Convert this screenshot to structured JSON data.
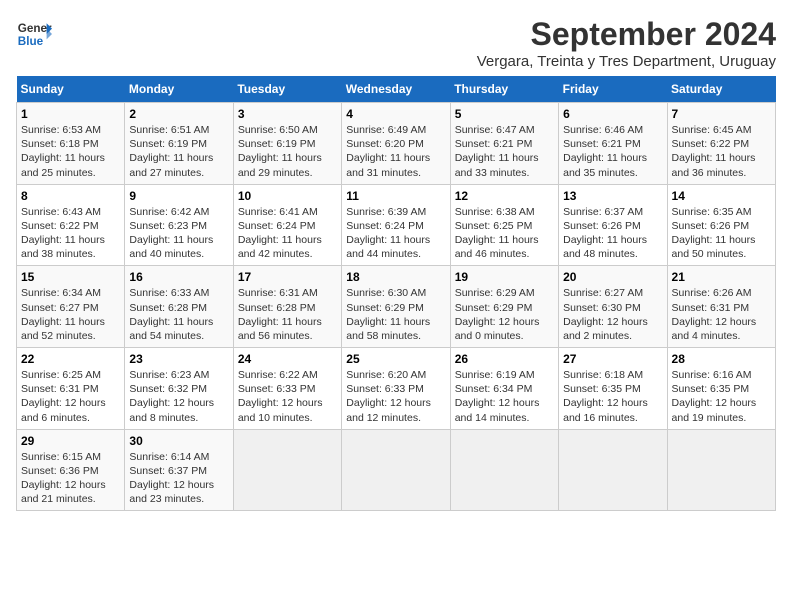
{
  "header": {
    "logo_line1": "General",
    "logo_line2": "Blue",
    "main_title": "September 2024",
    "subtitle": "Vergara, Treinta y Tres Department, Uruguay"
  },
  "days_of_week": [
    "Sunday",
    "Monday",
    "Tuesday",
    "Wednesday",
    "Thursday",
    "Friday",
    "Saturday"
  ],
  "weeks": [
    [
      {
        "day": "1",
        "lines": [
          "Sunrise: 6:53 AM",
          "Sunset: 6:18 PM",
          "Daylight: 11 hours",
          "and 25 minutes."
        ]
      },
      {
        "day": "2",
        "lines": [
          "Sunrise: 6:51 AM",
          "Sunset: 6:19 PM",
          "Daylight: 11 hours",
          "and 27 minutes."
        ]
      },
      {
        "day": "3",
        "lines": [
          "Sunrise: 6:50 AM",
          "Sunset: 6:19 PM",
          "Daylight: 11 hours",
          "and 29 minutes."
        ]
      },
      {
        "day": "4",
        "lines": [
          "Sunrise: 6:49 AM",
          "Sunset: 6:20 PM",
          "Daylight: 11 hours",
          "and 31 minutes."
        ]
      },
      {
        "day": "5",
        "lines": [
          "Sunrise: 6:47 AM",
          "Sunset: 6:21 PM",
          "Daylight: 11 hours",
          "and 33 minutes."
        ]
      },
      {
        "day": "6",
        "lines": [
          "Sunrise: 6:46 AM",
          "Sunset: 6:21 PM",
          "Daylight: 11 hours",
          "and 35 minutes."
        ]
      },
      {
        "day": "7",
        "lines": [
          "Sunrise: 6:45 AM",
          "Sunset: 6:22 PM",
          "Daylight: 11 hours",
          "and 36 minutes."
        ]
      }
    ],
    [
      {
        "day": "8",
        "lines": [
          "Sunrise: 6:43 AM",
          "Sunset: 6:22 PM",
          "Daylight: 11 hours",
          "and 38 minutes."
        ]
      },
      {
        "day": "9",
        "lines": [
          "Sunrise: 6:42 AM",
          "Sunset: 6:23 PM",
          "Daylight: 11 hours",
          "and 40 minutes."
        ]
      },
      {
        "day": "10",
        "lines": [
          "Sunrise: 6:41 AM",
          "Sunset: 6:24 PM",
          "Daylight: 11 hours",
          "and 42 minutes."
        ]
      },
      {
        "day": "11",
        "lines": [
          "Sunrise: 6:39 AM",
          "Sunset: 6:24 PM",
          "Daylight: 11 hours",
          "and 44 minutes."
        ]
      },
      {
        "day": "12",
        "lines": [
          "Sunrise: 6:38 AM",
          "Sunset: 6:25 PM",
          "Daylight: 11 hours",
          "and 46 minutes."
        ]
      },
      {
        "day": "13",
        "lines": [
          "Sunrise: 6:37 AM",
          "Sunset: 6:26 PM",
          "Daylight: 11 hours",
          "and 48 minutes."
        ]
      },
      {
        "day": "14",
        "lines": [
          "Sunrise: 6:35 AM",
          "Sunset: 6:26 PM",
          "Daylight: 11 hours",
          "and 50 minutes."
        ]
      }
    ],
    [
      {
        "day": "15",
        "lines": [
          "Sunrise: 6:34 AM",
          "Sunset: 6:27 PM",
          "Daylight: 11 hours",
          "and 52 minutes."
        ]
      },
      {
        "day": "16",
        "lines": [
          "Sunrise: 6:33 AM",
          "Sunset: 6:28 PM",
          "Daylight: 11 hours",
          "and 54 minutes."
        ]
      },
      {
        "day": "17",
        "lines": [
          "Sunrise: 6:31 AM",
          "Sunset: 6:28 PM",
          "Daylight: 11 hours",
          "and 56 minutes."
        ]
      },
      {
        "day": "18",
        "lines": [
          "Sunrise: 6:30 AM",
          "Sunset: 6:29 PM",
          "Daylight: 11 hours",
          "and 58 minutes."
        ]
      },
      {
        "day": "19",
        "lines": [
          "Sunrise: 6:29 AM",
          "Sunset: 6:29 PM",
          "Daylight: 12 hours",
          "and 0 minutes."
        ]
      },
      {
        "day": "20",
        "lines": [
          "Sunrise: 6:27 AM",
          "Sunset: 6:30 PM",
          "Daylight: 12 hours",
          "and 2 minutes."
        ]
      },
      {
        "day": "21",
        "lines": [
          "Sunrise: 6:26 AM",
          "Sunset: 6:31 PM",
          "Daylight: 12 hours",
          "and 4 minutes."
        ]
      }
    ],
    [
      {
        "day": "22",
        "lines": [
          "Sunrise: 6:25 AM",
          "Sunset: 6:31 PM",
          "Daylight: 12 hours",
          "and 6 minutes."
        ]
      },
      {
        "day": "23",
        "lines": [
          "Sunrise: 6:23 AM",
          "Sunset: 6:32 PM",
          "Daylight: 12 hours",
          "and 8 minutes."
        ]
      },
      {
        "day": "24",
        "lines": [
          "Sunrise: 6:22 AM",
          "Sunset: 6:33 PM",
          "Daylight: 12 hours",
          "and 10 minutes."
        ]
      },
      {
        "day": "25",
        "lines": [
          "Sunrise: 6:20 AM",
          "Sunset: 6:33 PM",
          "Daylight: 12 hours",
          "and 12 minutes."
        ]
      },
      {
        "day": "26",
        "lines": [
          "Sunrise: 6:19 AM",
          "Sunset: 6:34 PM",
          "Daylight: 12 hours",
          "and 14 minutes."
        ]
      },
      {
        "day": "27",
        "lines": [
          "Sunrise: 6:18 AM",
          "Sunset: 6:35 PM",
          "Daylight: 12 hours",
          "and 16 minutes."
        ]
      },
      {
        "day": "28",
        "lines": [
          "Sunrise: 6:16 AM",
          "Sunset: 6:35 PM",
          "Daylight: 12 hours",
          "and 19 minutes."
        ]
      }
    ],
    [
      {
        "day": "29",
        "lines": [
          "Sunrise: 6:15 AM",
          "Sunset: 6:36 PM",
          "Daylight: 12 hours",
          "and 21 minutes."
        ]
      },
      {
        "day": "30",
        "lines": [
          "Sunrise: 6:14 AM",
          "Sunset: 6:37 PM",
          "Daylight: 12 hours",
          "and 23 minutes."
        ]
      },
      {
        "day": "",
        "lines": []
      },
      {
        "day": "",
        "lines": []
      },
      {
        "day": "",
        "lines": []
      },
      {
        "day": "",
        "lines": []
      },
      {
        "day": "",
        "lines": []
      }
    ]
  ]
}
